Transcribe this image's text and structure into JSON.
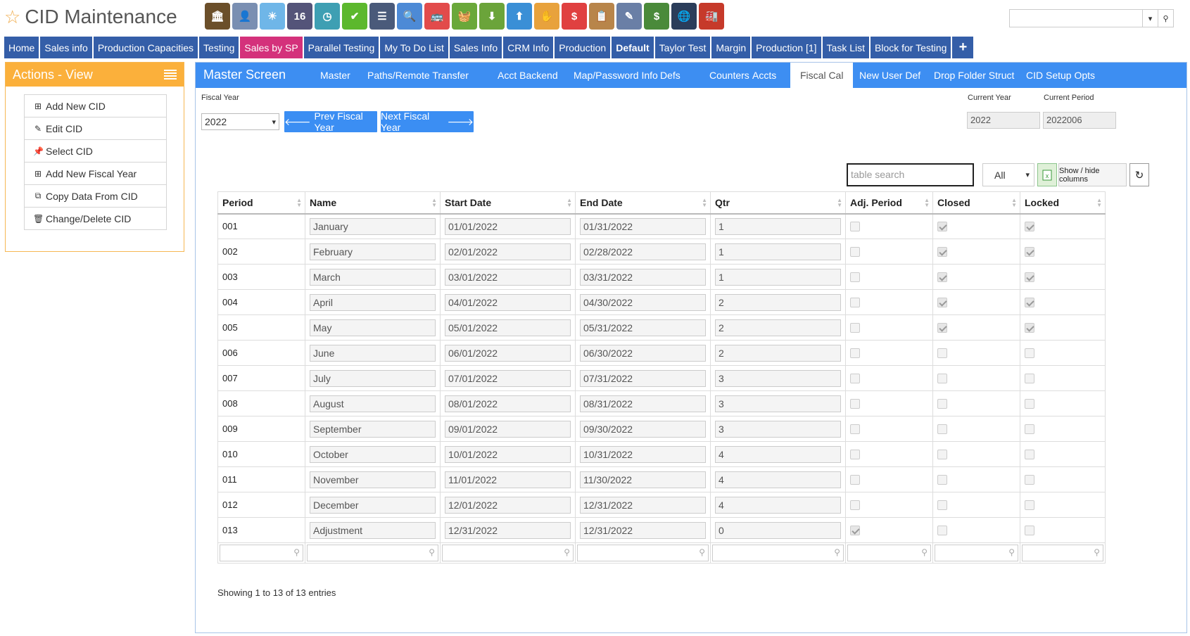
{
  "app": {
    "title": "CID Maintenance"
  },
  "toolbar": {
    "icons": [
      {
        "name": "bank-icon",
        "color": "#6b4f2a",
        "glyph": "🏛"
      },
      {
        "name": "user-icon",
        "color": "#7a8fb2",
        "glyph": "👤"
      },
      {
        "name": "weather-icon",
        "color": "#6fb6e8",
        "glyph": "☀"
      },
      {
        "name": "calendar-icon",
        "color": "#545479",
        "glyph": "16"
      },
      {
        "name": "clock-icon",
        "color": "#3e9fb3",
        "glyph": "◷"
      },
      {
        "name": "checkmark-icon",
        "color": "#5cb82d",
        "glyph": "✔"
      },
      {
        "name": "document-list-icon",
        "color": "#4a5a7a",
        "glyph": "☰"
      },
      {
        "name": "magnifier-icon",
        "color": "#4d8ad6",
        "glyph": "🔍"
      },
      {
        "name": "bus-icon",
        "color": "#e24b4b",
        "glyph": "🚌"
      },
      {
        "name": "basket-icon",
        "color": "#6aa83a",
        "glyph": "🧺"
      },
      {
        "name": "download-box-icon",
        "color": "#6ba43a",
        "glyph": "⬇"
      },
      {
        "name": "upload-box-icon",
        "color": "#3a8fd6",
        "glyph": "⬆"
      },
      {
        "name": "coins-hand-icon",
        "color": "#e8a23c",
        "glyph": "✋"
      },
      {
        "name": "dollar-chat-icon",
        "color": "#e04040",
        "glyph": "$"
      },
      {
        "name": "clipboard-icon",
        "color": "#b8854a",
        "glyph": "📋"
      },
      {
        "name": "pencil-paper-icon",
        "color": "#6a7fa6",
        "glyph": "✎"
      },
      {
        "name": "money-icon",
        "color": "#4a8a3a",
        "glyph": "$"
      },
      {
        "name": "globe-device-icon",
        "color": "#2b3d5a",
        "glyph": "🌐"
      },
      {
        "name": "factory-icon",
        "color": "#c63a2a",
        "glyph": "🏭"
      }
    ]
  },
  "search": {
    "placeholder": "",
    "value": ""
  },
  "nav": {
    "items": [
      {
        "label": "Home",
        "style": ""
      },
      {
        "label": "Sales info",
        "style": ""
      },
      {
        "label": "Production Capacities",
        "style": ""
      },
      {
        "label": "Testing",
        "style": ""
      },
      {
        "label": "Sales by SP",
        "style": "active-pink"
      },
      {
        "label": "Parallel Testing",
        "style": ""
      },
      {
        "label": "My To Do List",
        "style": ""
      },
      {
        "label": "Sales Info",
        "style": ""
      },
      {
        "label": "CRM Info",
        "style": ""
      },
      {
        "label": "Production",
        "style": ""
      },
      {
        "label": "Default",
        "style": "bold"
      },
      {
        "label": "Taylor Test",
        "style": ""
      },
      {
        "label": "Margin",
        "style": ""
      },
      {
        "label": "Production [1]",
        "style": ""
      },
      {
        "label": "Task List",
        "style": ""
      },
      {
        "label": "Block for Testing",
        "style": ""
      }
    ],
    "plus_label": "+"
  },
  "sidebar": {
    "title": "Actions - View",
    "items": [
      {
        "label": "Add New CID",
        "icon": "plus-square-icon",
        "glyph": "⊞"
      },
      {
        "label": "Edit CID",
        "icon": "pencil-icon",
        "glyph": "✎"
      },
      {
        "label": "Select CID",
        "icon": "pin-icon",
        "glyph": "📌"
      },
      {
        "label": "Add New Fiscal Year",
        "icon": "plus-square-icon",
        "glyph": "⊞"
      },
      {
        "label": "Copy Data From CID",
        "icon": "copy-icon",
        "glyph": "⧉"
      },
      {
        "label": "Change/Delete CID",
        "icon": "trash-icon",
        "glyph": "🗑"
      }
    ]
  },
  "master": {
    "title": "Master Screen",
    "tabs": [
      {
        "label": "Master",
        "active": false
      },
      {
        "label": "Paths/Remote Transfer",
        "active": false
      },
      {
        "label": "Acct Backend",
        "active": false
      },
      {
        "label": "Map/Password Info",
        "active": false
      },
      {
        "label": "Defs",
        "active": false
      },
      {
        "label": "Counters",
        "active": false
      },
      {
        "label": "Accts",
        "active": false
      },
      {
        "label": "Fiscal Cal",
        "active": true
      },
      {
        "label": "New User Def",
        "active": false
      },
      {
        "label": "Drop Folder Struct",
        "active": false
      },
      {
        "label": "CID Setup Opts",
        "active": false
      }
    ]
  },
  "fiscal": {
    "year_label": "Fiscal Year",
    "year_value": "2022",
    "prev_label": "Prev Fiscal Year",
    "next_label": "Next Fiscal Year",
    "current_year_label": "Current Year",
    "current_year_value": "2022",
    "current_period_label": "Current Period",
    "current_period_value": "2022006"
  },
  "table_controls": {
    "search_placeholder": "table search",
    "page_size": "All",
    "columns_button": "Show / hide columns"
  },
  "table": {
    "columns": [
      "Period",
      "Name",
      "Start Date",
      "End Date",
      "Qtr",
      "Adj. Period",
      "Closed",
      "Locked"
    ],
    "rows": [
      {
        "period": "001",
        "name": "January",
        "start": "01/01/2022",
        "end": "01/31/2022",
        "qtr": "1",
        "adj": false,
        "closed": true,
        "locked": true
      },
      {
        "period": "002",
        "name": "February",
        "start": "02/01/2022",
        "end": "02/28/2022",
        "qtr": "1",
        "adj": false,
        "closed": true,
        "locked": true
      },
      {
        "period": "003",
        "name": "March",
        "start": "03/01/2022",
        "end": "03/31/2022",
        "qtr": "1",
        "adj": false,
        "closed": true,
        "locked": true
      },
      {
        "period": "004",
        "name": "April",
        "start": "04/01/2022",
        "end": "04/30/2022",
        "qtr": "2",
        "adj": false,
        "closed": true,
        "locked": true
      },
      {
        "period": "005",
        "name": "May",
        "start": "05/01/2022",
        "end": "05/31/2022",
        "qtr": "2",
        "adj": false,
        "closed": true,
        "locked": true
      },
      {
        "period": "006",
        "name": "June",
        "start": "06/01/2022",
        "end": "06/30/2022",
        "qtr": "2",
        "adj": false,
        "closed": false,
        "locked": false
      },
      {
        "period": "007",
        "name": "July",
        "start": "07/01/2022",
        "end": "07/31/2022",
        "qtr": "3",
        "adj": false,
        "closed": false,
        "locked": false
      },
      {
        "period": "008",
        "name": "August",
        "start": "08/01/2022",
        "end": "08/31/2022",
        "qtr": "3",
        "adj": false,
        "closed": false,
        "locked": false
      },
      {
        "period": "009",
        "name": "September",
        "start": "09/01/2022",
        "end": "09/30/2022",
        "qtr": "3",
        "adj": false,
        "closed": false,
        "locked": false
      },
      {
        "period": "010",
        "name": "October",
        "start": "10/01/2022",
        "end": "10/31/2022",
        "qtr": "4",
        "adj": false,
        "closed": false,
        "locked": false
      },
      {
        "period": "011",
        "name": "November",
        "start": "11/01/2022",
        "end": "11/30/2022",
        "qtr": "4",
        "adj": false,
        "closed": false,
        "locked": false
      },
      {
        "period": "012",
        "name": "December",
        "start": "12/01/2022",
        "end": "12/31/2022",
        "qtr": "4",
        "adj": false,
        "closed": false,
        "locked": false
      },
      {
        "period": "013",
        "name": "Adjustment",
        "start": "12/31/2022",
        "end": "12/31/2022",
        "qtr": "0",
        "adj": true,
        "closed": false,
        "locked": false
      }
    ],
    "info": "Showing 1 to 13 of 13 entries"
  }
}
